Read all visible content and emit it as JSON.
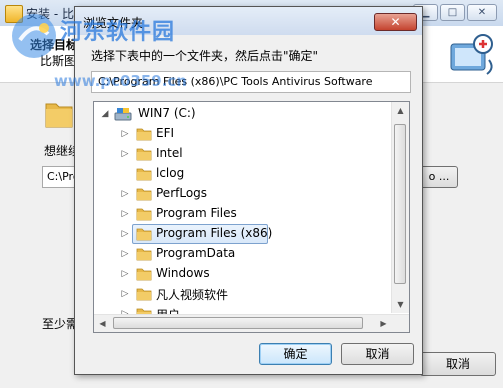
{
  "installer": {
    "title": "安装 - 比斯图杀毒软件",
    "heading": "选择目标位置",
    "subheading": "比斯图杀毒软件安装到哪里？",
    "question": "想继续",
    "path_value": "C:\\Pro",
    "browse_label": "浏览(R)...",
    "browse_visible": "o ...",
    "space_text": "至少需",
    "cancel_label": "取消"
  },
  "watermark": {
    "text": "河东软件园",
    "url": "www.pc0359.cn"
  },
  "dialog": {
    "title": "浏览文件夹",
    "close_label": "✕",
    "instruction": "选择下表中的一个文件夹，然后点击\"确定\"",
    "path": "C:\\Program Files (x86)\\PC Tools Antivirus Software",
    "ok_label": "确定",
    "cancel_label": "取消",
    "tree": {
      "drive": "WIN7 (C:)",
      "folders": [
        {
          "label": "EFI",
          "expandable": true
        },
        {
          "label": "Intel",
          "expandable": true
        },
        {
          "label": "lclog",
          "expandable": false
        },
        {
          "label": "PerfLogs",
          "expandable": true
        },
        {
          "label": "Program Files",
          "expandable": true
        },
        {
          "label": "Program Files (x86)",
          "expandable": true,
          "selected": true
        },
        {
          "label": "ProgramData",
          "expandable": true
        },
        {
          "label": "Windows",
          "expandable": true
        },
        {
          "label": "凡人视频软件",
          "expandable": true
        },
        {
          "label": "用户",
          "expandable": true
        }
      ]
    }
  },
  "colors": {
    "selection_border": "#7da2ce",
    "selection_fill": "#d9e8f9",
    "folder": "#e8b94a",
    "close_button": "#c4432f"
  }
}
